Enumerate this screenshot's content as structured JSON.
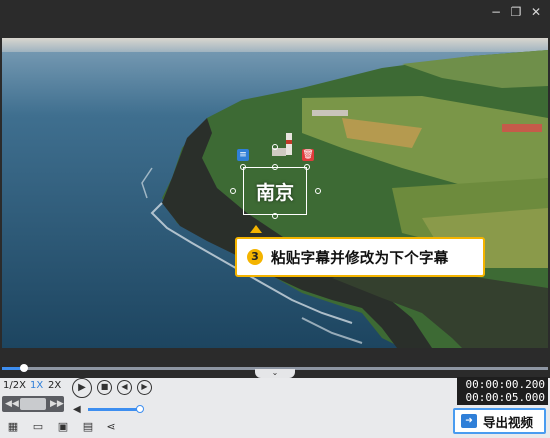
{
  "window": {
    "controls": {
      "minimize": "−",
      "restore": "❐",
      "close": "✕"
    }
  },
  "video": {
    "caption_text": "南京",
    "edit_icon": "≡",
    "delete_icon": "🗑"
  },
  "tooltip": {
    "step_number": "3",
    "text": "粘贴字幕并修改为下个字幕"
  },
  "playback": {
    "progress_fraction": 0.04,
    "collapse_glyph": "⌄",
    "speeds": [
      "1/2X",
      "1X",
      "2X"
    ],
    "active_speed": "1X",
    "play_icon": "▶",
    "stop_icon": "■",
    "prev_icon": "◀",
    "next_icon": "▶",
    "rewind_glyph": "◀◀",
    "forward_glyph": "▶▶",
    "volume_icon": "◀",
    "volume_fraction": 0.9,
    "current_time": "00:00:00.200",
    "total_time": "00:00:05.000"
  },
  "toolbar": {
    "export_label": "导出视频",
    "tools": [
      "new-project-icon",
      "open-folder-icon",
      "save-icon",
      "save-as-icon",
      "share-icon"
    ]
  },
  "colors": {
    "accent": "#3d8ef0",
    "tooltip_border": "#f4b400",
    "dark_bg": "#2b2b2b",
    "panel_bg": "#e9eaec"
  }
}
